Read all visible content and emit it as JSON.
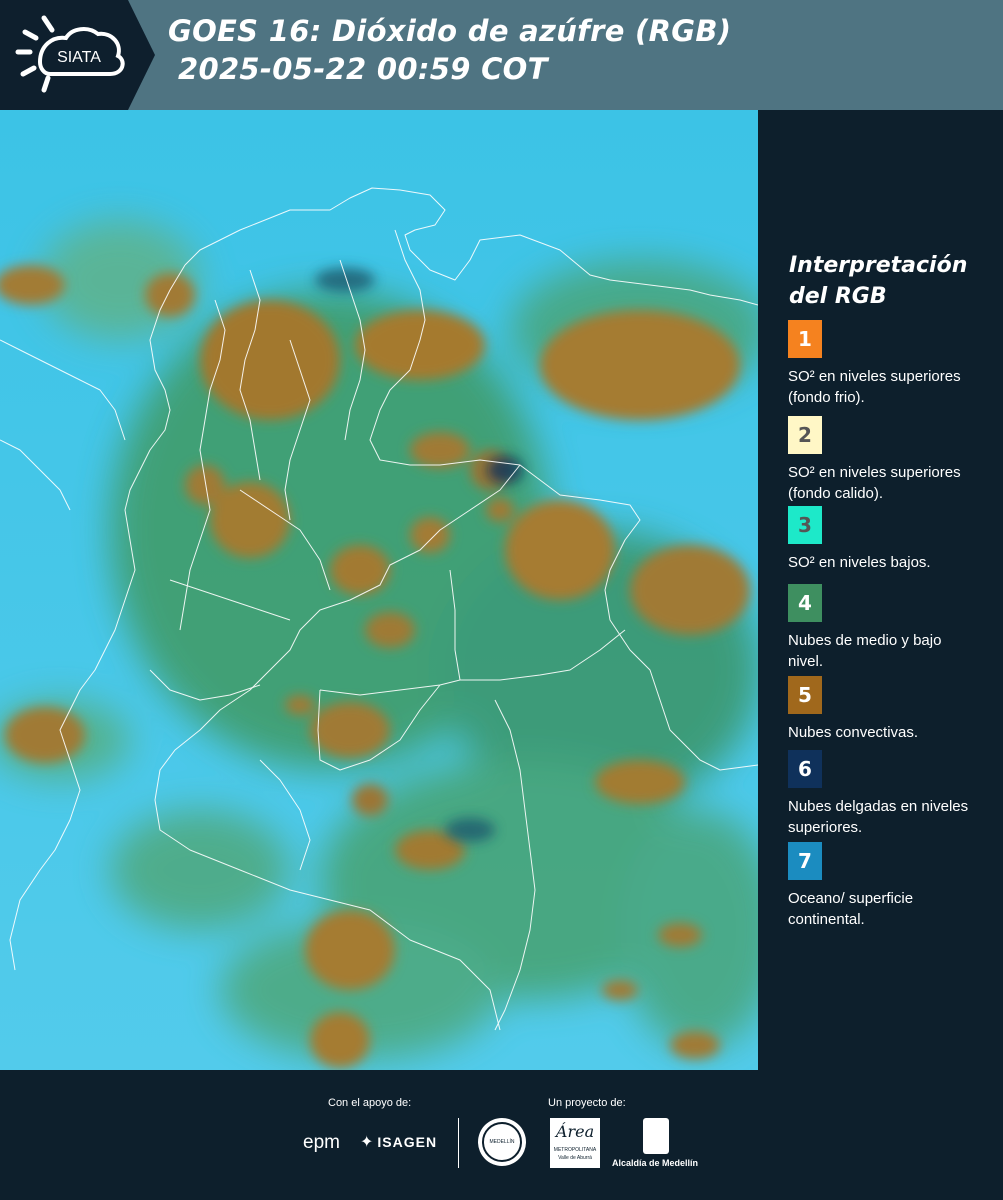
{
  "header": {
    "logo_text": "SIATA",
    "title_line1": "GOES 16: Dióxido de azúfre (RGB)",
    "title_line2": "2025-05-22 00:59 COT"
  },
  "legend": {
    "title_line1": "Interpretación",
    "title_line2": "del RGB",
    "items": [
      {
        "num": "1",
        "color": "#f5821f",
        "text_color": "#ffffff",
        "label": "SO² en niveles superiores (fondo frio)."
      },
      {
        "num": "2",
        "color": "#fff7c6",
        "text_color": "#555555",
        "label": "SO² en niveles superiores (fondo calido)."
      },
      {
        "num": "3",
        "color": "#1de9c9",
        "text_color": "#555555",
        "label": "SO² en niveles bajos."
      },
      {
        "num": "4",
        "color": "#3e8f60",
        "text_color": "#ffffff",
        "label": "Nubes de medio y bajo nivel."
      },
      {
        "num": "5",
        "color": "#a0681c",
        "text_color": "#ffffff",
        "label": "Nubes convectivas."
      },
      {
        "num": "6",
        "color": "#0f315b",
        "text_color": "#ffffff",
        "label": "Nubes delgadas en niveles superiores."
      },
      {
        "num": "7",
        "color": "#1b8cc0",
        "text_color": "#ffffff",
        "label": "Oceano/ superficie continental."
      }
    ]
  },
  "footer": {
    "support_label": "Con el apoyo de:",
    "project_label": "Un proyecto de:",
    "logo_epm": "epm",
    "logo_isagen": "ISAGEN",
    "logo_area": "Área",
    "logo_area_sub": "METROPOLITANA",
    "logo_area_sub2": "Valle de Aburrá",
    "logo_alcaldia": "Alcaldía de Medellín",
    "logo_medellin_seal": "MEDELLÍN"
  }
}
